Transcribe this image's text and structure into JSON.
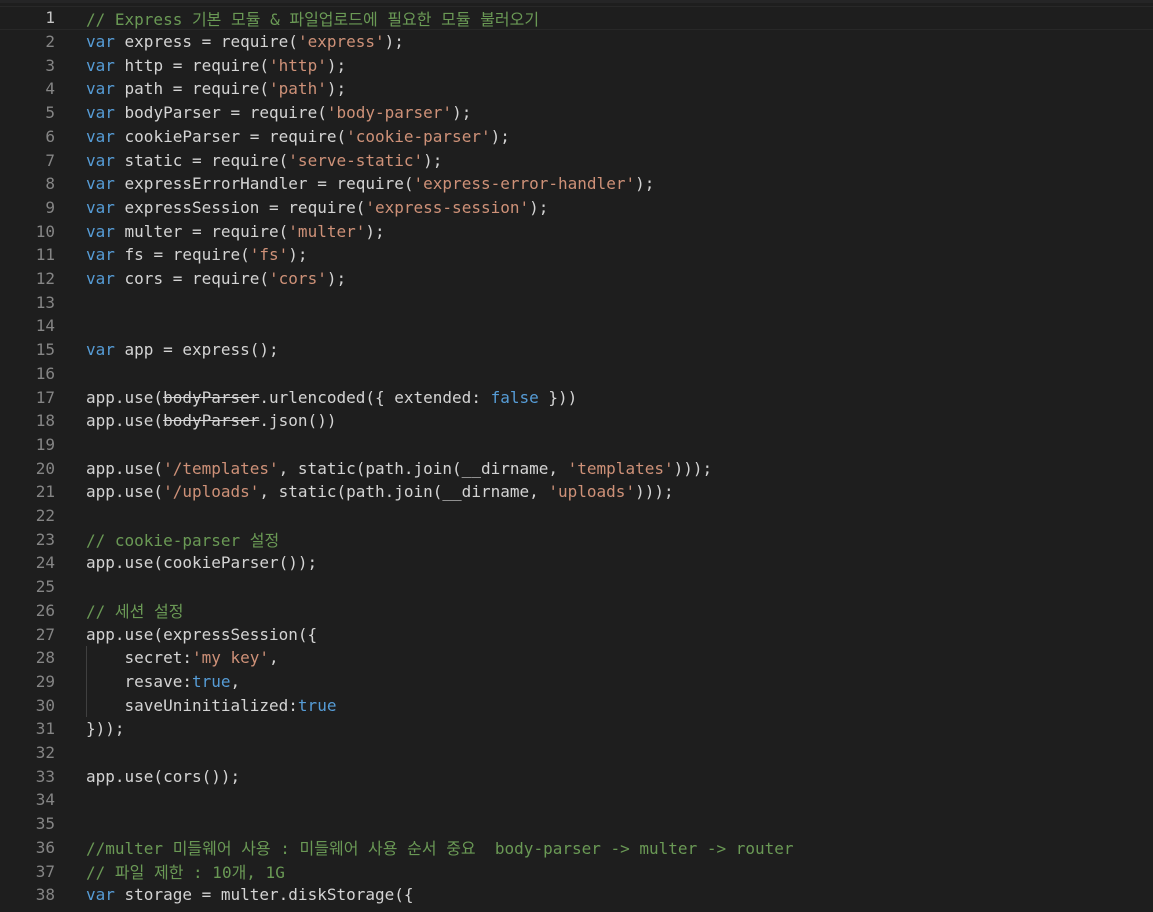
{
  "editor": {
    "lines": [
      {
        "n": "1",
        "tokens": [
          {
            "t": "// Express 기본 모듈 & 파일업로드에 필요한 모듈 불러오기",
            "c": "cmt"
          }
        ]
      },
      {
        "n": "2",
        "tokens": [
          {
            "t": "var",
            "c": "kw"
          },
          {
            "t": " express = require(",
            "c": "plain"
          },
          {
            "t": "'express'",
            "c": "str"
          },
          {
            "t": ");",
            "c": "plain"
          }
        ]
      },
      {
        "n": "3",
        "tokens": [
          {
            "t": "var",
            "c": "kw"
          },
          {
            "t": " http = require(",
            "c": "plain"
          },
          {
            "t": "'http'",
            "c": "str"
          },
          {
            "t": ");",
            "c": "plain"
          }
        ]
      },
      {
        "n": "4",
        "tokens": [
          {
            "t": "var",
            "c": "kw"
          },
          {
            "t": " path = require(",
            "c": "plain"
          },
          {
            "t": "'path'",
            "c": "str"
          },
          {
            "t": ");",
            "c": "plain"
          }
        ]
      },
      {
        "n": "5",
        "tokens": [
          {
            "t": "var",
            "c": "kw"
          },
          {
            "t": " bodyParser = require(",
            "c": "plain"
          },
          {
            "t": "'body-parser'",
            "c": "str"
          },
          {
            "t": ");",
            "c": "plain"
          }
        ]
      },
      {
        "n": "6",
        "tokens": [
          {
            "t": "var",
            "c": "kw"
          },
          {
            "t": " cookieParser = require(",
            "c": "plain"
          },
          {
            "t": "'cookie-parser'",
            "c": "str"
          },
          {
            "t": ");",
            "c": "plain"
          }
        ]
      },
      {
        "n": "7",
        "tokens": [
          {
            "t": "var",
            "c": "kw"
          },
          {
            "t": " static = require(",
            "c": "plain"
          },
          {
            "t": "'serve-static'",
            "c": "str"
          },
          {
            "t": ");",
            "c": "plain"
          }
        ]
      },
      {
        "n": "8",
        "tokens": [
          {
            "t": "var",
            "c": "kw"
          },
          {
            "t": " expressErrorHandler = require(",
            "c": "plain"
          },
          {
            "t": "'express-error-handler'",
            "c": "str"
          },
          {
            "t": ");",
            "c": "plain"
          }
        ]
      },
      {
        "n": "9",
        "tokens": [
          {
            "t": "var",
            "c": "kw"
          },
          {
            "t": " expressSession = require(",
            "c": "plain"
          },
          {
            "t": "'express-session'",
            "c": "str"
          },
          {
            "t": ");",
            "c": "plain"
          }
        ]
      },
      {
        "n": "10",
        "tokens": [
          {
            "t": "var",
            "c": "kw"
          },
          {
            "t": " multer = require(",
            "c": "plain"
          },
          {
            "t": "'multer'",
            "c": "str"
          },
          {
            "t": ");",
            "c": "plain"
          }
        ]
      },
      {
        "n": "11",
        "tokens": [
          {
            "t": "var",
            "c": "kw"
          },
          {
            "t": " fs = require(",
            "c": "plain"
          },
          {
            "t": "'fs'",
            "c": "str"
          },
          {
            "t": ");",
            "c": "plain"
          }
        ]
      },
      {
        "n": "12",
        "tokens": [
          {
            "t": "var",
            "c": "kw"
          },
          {
            "t": " cors = require(",
            "c": "plain"
          },
          {
            "t": "'cors'",
            "c": "str"
          },
          {
            "t": ");",
            "c": "plain"
          }
        ]
      },
      {
        "n": "13",
        "tokens": []
      },
      {
        "n": "14",
        "tokens": []
      },
      {
        "n": "15",
        "tokens": [
          {
            "t": "var",
            "c": "kw"
          },
          {
            "t": " app = express();",
            "c": "plain"
          }
        ]
      },
      {
        "n": "16",
        "tokens": []
      },
      {
        "n": "17",
        "tokens": [
          {
            "t": "app.use(",
            "c": "plain"
          },
          {
            "t": "bodyParser",
            "c": "plain strike"
          },
          {
            "t": ".urlencoded({ extended: ",
            "c": "plain"
          },
          {
            "t": "false",
            "c": "kw"
          },
          {
            "t": " }))",
            "c": "plain"
          }
        ]
      },
      {
        "n": "18",
        "tokens": [
          {
            "t": "app.use(",
            "c": "plain"
          },
          {
            "t": "bodyParser",
            "c": "plain strike"
          },
          {
            "t": ".json())",
            "c": "plain"
          }
        ]
      },
      {
        "n": "19",
        "tokens": []
      },
      {
        "n": "20",
        "tokens": [
          {
            "t": "app.use(",
            "c": "plain"
          },
          {
            "t": "'/templates'",
            "c": "str"
          },
          {
            "t": ", static(path.join(__dirname, ",
            "c": "plain"
          },
          {
            "t": "'templates'",
            "c": "str"
          },
          {
            "t": ")));",
            "c": "plain"
          }
        ]
      },
      {
        "n": "21",
        "tokens": [
          {
            "t": "app.use(",
            "c": "plain"
          },
          {
            "t": "'/uploads'",
            "c": "str"
          },
          {
            "t": ", static(path.join(__dirname, ",
            "c": "plain"
          },
          {
            "t": "'uploads'",
            "c": "str"
          },
          {
            "t": ")));",
            "c": "plain"
          }
        ]
      },
      {
        "n": "22",
        "tokens": []
      },
      {
        "n": "23",
        "tokens": [
          {
            "t": "// cookie-parser 설정",
            "c": "cmt"
          }
        ]
      },
      {
        "n": "24",
        "tokens": [
          {
            "t": "app.use(cookieParser());",
            "c": "plain"
          }
        ]
      },
      {
        "n": "25",
        "tokens": []
      },
      {
        "n": "26",
        "tokens": [
          {
            "t": "// 세션 설정",
            "c": "cmt"
          }
        ]
      },
      {
        "n": "27",
        "tokens": [
          {
            "t": "app.use(expressSession({",
            "c": "plain"
          }
        ]
      },
      {
        "n": "28",
        "tokens": [
          {
            "t": "    secret:",
            "c": "plain"
          },
          {
            "t": "'my key'",
            "c": "str"
          },
          {
            "t": ",",
            "c": "plain"
          }
        ]
      },
      {
        "n": "29",
        "tokens": [
          {
            "t": "    resave:",
            "c": "plain"
          },
          {
            "t": "true",
            "c": "kw"
          },
          {
            "t": ",",
            "c": "plain"
          }
        ]
      },
      {
        "n": "30",
        "tokens": [
          {
            "t": "    saveUninitialized:",
            "c": "plain"
          },
          {
            "t": "true",
            "c": "kw"
          }
        ]
      },
      {
        "n": "31",
        "tokens": [
          {
            "t": "}));",
            "c": "plain"
          }
        ]
      },
      {
        "n": "32",
        "tokens": []
      },
      {
        "n": "33",
        "tokens": [
          {
            "t": "app.use(cors());",
            "c": "plain"
          }
        ]
      },
      {
        "n": "34",
        "tokens": []
      },
      {
        "n": "35",
        "tokens": []
      },
      {
        "n": "36",
        "tokens": [
          {
            "t": "//multer 미들웨어 사용 : 미들웨어 사용 순서 중요  body-parser -> multer -> router",
            "c": "cmt"
          }
        ]
      },
      {
        "n": "37",
        "tokens": [
          {
            "t": "// 파일 제한 : 10개, 1G",
            "c": "cmt"
          }
        ]
      },
      {
        "n": "38",
        "tokens": [
          {
            "t": "var",
            "c": "kw"
          },
          {
            "t": " storage = multer.diskStorage({",
            "c": "plain"
          }
        ]
      }
    ],
    "current_line": "1"
  }
}
